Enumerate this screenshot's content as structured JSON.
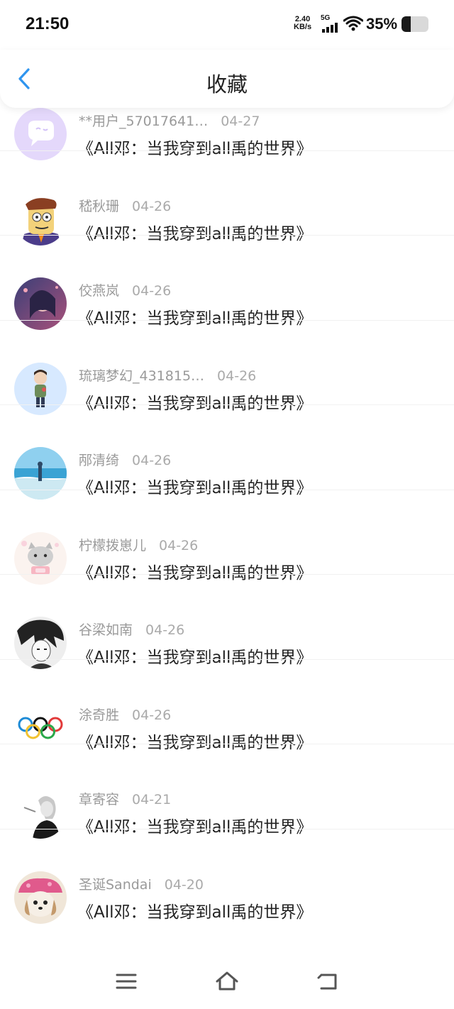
{
  "status_bar": {
    "time": "21:50",
    "net_speed_value": "2.40",
    "net_speed_unit": "KB/s",
    "network_type": "5G",
    "battery_percent": "35%",
    "battery_level": 0.35
  },
  "header": {
    "title": "收藏"
  },
  "list": [
    {
      "name": "**用户_57017641…",
      "date": "04-27",
      "book": "《All邓：当我穿到all禹的世界》",
      "avatar": "default-avatar-icon"
    },
    {
      "name": "嵇秋珊",
      "date": "04-26",
      "book": "《All邓：当我穿到all禹的世界》",
      "avatar": "cartoon-man-avatar"
    },
    {
      "name": "佼燕岚",
      "date": "04-26",
      "book": "《All邓：当我穿到all禹的世界》",
      "avatar": "anime-girl-avatar"
    },
    {
      "name": "琉璃梦幻_431815…",
      "date": "04-26",
      "book": "《All邓：当我穿到all禹的世界》",
      "avatar": "chibi-figure-avatar"
    },
    {
      "name": "邴清绮",
      "date": "04-26",
      "book": "《All邓：当我穿到all禹的世界》",
      "avatar": "beach-scene-avatar"
    },
    {
      "name": "柠檬拨崽儿",
      "date": "04-26",
      "book": "《All邓：当我穿到all禹的世界》",
      "avatar": "cute-cat-avatar"
    },
    {
      "name": "谷梁如南",
      "date": "04-26",
      "book": "《All邓：当我穿到all禹的世界》",
      "avatar": "manga-sketch-avatar"
    },
    {
      "name": "涂奇胜",
      "date": "04-26",
      "book": "《All邓：当我穿到all禹的世界》",
      "avatar": "olympic-rings-avatar"
    },
    {
      "name": "章寄容",
      "date": "04-21",
      "book": "《All邓：当我穿到all禹的世界》",
      "avatar": "bw-portrait-avatar"
    },
    {
      "name": "圣诞Sandai",
      "date": "04-20",
      "book": "《All邓：当我穿到all禹的世界》",
      "avatar": "puppy-hat-avatar"
    }
  ],
  "nav_bar": {
    "items": [
      "menu-icon",
      "home-icon",
      "back-icon"
    ]
  },
  "colors": {
    "accent": "#2f95ef",
    "text_primary": "#222222",
    "text_secondary": "#9a9a9a"
  }
}
